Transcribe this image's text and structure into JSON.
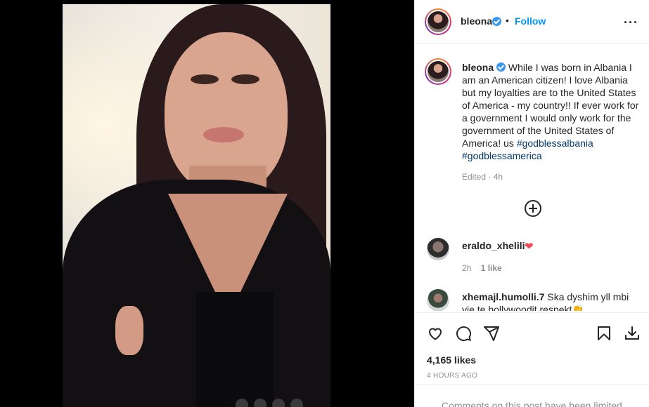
{
  "post": {
    "username": "bleona",
    "dot": "•",
    "follow_label": "Follow",
    "more_icon": "more-horizontal-icon"
  },
  "caption": {
    "username": "bleona",
    "text": "While I was born in Albania I am an American citizen! I love Albania but my loyalties are to the United States of America - my country!! If ever work for a government I would only work for the government of the United States of America! us",
    "hashtags": "#godblessalbania #godblessamerica",
    "edited": "Edited · 4h"
  },
  "comments": [
    {
      "username": "eraldo_xhelili",
      "text": "❤",
      "time": "2h",
      "likes": "1 like"
    },
    {
      "username": "xhemajl.humolli.7",
      "text": "Ska dyshim yll mbi yje te hollywoodit respekt👏"
    }
  ],
  "actions": {
    "like_icon": "heart-icon",
    "comment_icon": "comment-icon",
    "share_icon": "share-icon",
    "save_icon": "bookmark-icon",
    "download_icon": "download-icon"
  },
  "likes_count": "4,165 likes",
  "time_ago": "4 HOURS AGO",
  "comments_limited": "Comments on this post have been limited.",
  "colors": {
    "link_blue": "#0095f6",
    "verified_blue": "#3897f0",
    "hashtag": "#00376b",
    "heart_red": "#ed4956",
    "muted": "#8e8e8e"
  }
}
